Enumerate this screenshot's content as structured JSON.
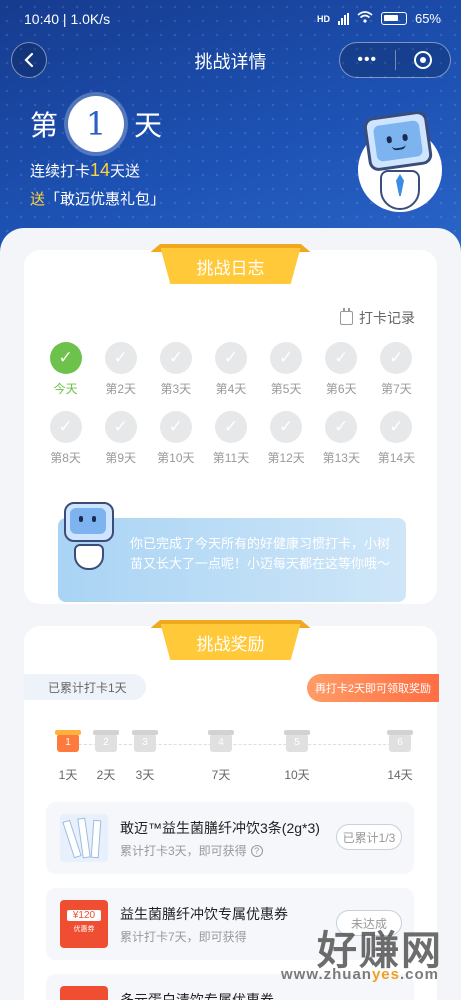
{
  "status_bar": {
    "time_speed": "10:40 | 1.0K/s",
    "signal": "HD",
    "battery": "65%"
  },
  "nav": {
    "title": "挑战详情",
    "back_icon": "‹",
    "more_icon": "•••"
  },
  "hero": {
    "day_prefix": "第",
    "day_number": "1",
    "day_suffix": "天",
    "streak_prefix": "连续打卡",
    "streak_days": "14",
    "streak_suffix": "天送",
    "gift_prefix": "送",
    "gift_name": "「敢迈优惠礼包」"
  },
  "log": {
    "title": "挑战日志",
    "record_link": "打卡记录",
    "days": [
      {
        "label": "今天",
        "done": true
      },
      {
        "label": "第2天"
      },
      {
        "label": "第3天"
      },
      {
        "label": "第4天"
      },
      {
        "label": "第5天"
      },
      {
        "label": "第6天"
      },
      {
        "label": "第7天"
      },
      {
        "label": "第8天"
      },
      {
        "label": "第9天"
      },
      {
        "label": "第10天"
      },
      {
        "label": "第11天"
      },
      {
        "label": "第12天"
      },
      {
        "label": "第13天"
      },
      {
        "label": "第14天"
      }
    ],
    "check_mark": "✓",
    "tip": "你已完成了今天所有的好健康习惯打卡，小树苗又长大了一点呢！小迈每天都在这等你哦～"
  },
  "rewards": {
    "title": "挑战奖励",
    "progress": "已累计打卡1天",
    "hint": "再打卡2天即可领取奖励",
    "milestones": [
      {
        "label": "1天",
        "box": "1",
        "active": true
      },
      {
        "label": "2天",
        "box": "2"
      },
      {
        "label": "3天",
        "box": "3"
      },
      {
        "label": "7天",
        "box": "4"
      },
      {
        "label": "10天",
        "box": "5"
      },
      {
        "label": "14天",
        "box": "6"
      }
    ],
    "items": [
      {
        "title": "敢迈™益生菌膳纤冲饮3条(2g*3)",
        "subtitle": "累计打卡3天，即可获得",
        "button": "已累计1/3"
      },
      {
        "title": "益生菌膳纤冲饮专属优惠券",
        "subtitle": "累计打卡7天，即可获得",
        "button": "未达成",
        "coupon_amount": "¥120",
        "coupon_label": "优惠券"
      },
      {
        "title": "多元蛋白清饮专属优惠券",
        "subtitle": "",
        "button": ""
      }
    ]
  },
  "watermark": {
    "text": "好赚网",
    "url_prefix": "www.zhuan",
    "url_highlight": "yes",
    "url_suffix": ".com"
  },
  "colors": {
    "brand_blue": "#1d52b4",
    "accent_yellow": "#ffc93a",
    "done_green": "#6cc24a",
    "orange": "#ff6e43"
  }
}
